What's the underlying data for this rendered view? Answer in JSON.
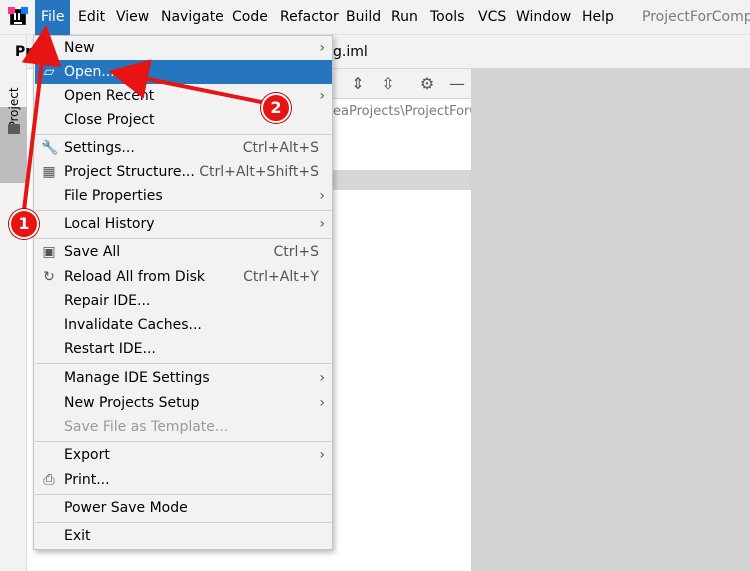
{
  "menubar": {
    "items": [
      "File",
      "Edit",
      "View",
      "Navigate",
      "Code",
      "Refactor",
      "Build",
      "Run",
      "Tools",
      "VCS",
      "Window",
      "Help"
    ],
    "title": "ProjectForComp("
  },
  "left_stripe": {
    "project_tab": "Project"
  },
  "tabs": {
    "left": "Pro",
    "file": "g.iml"
  },
  "project_path": "eaProjects\\ProjectForC",
  "file_menu": {
    "new": {
      "label": "New"
    },
    "open": {
      "label": "Open..."
    },
    "open_recent": {
      "label": "Open Recent"
    },
    "close_project": {
      "label": "Close Project"
    },
    "settings": {
      "label": "Settings...",
      "shortcut": "Ctrl+Alt+S"
    },
    "project_structure": {
      "label": "Project Structure...",
      "shortcut": "Ctrl+Alt+Shift+S"
    },
    "file_properties": {
      "label": "File Properties"
    },
    "local_history": {
      "label": "Local History"
    },
    "save_all": {
      "label": "Save All",
      "shortcut": "Ctrl+S"
    },
    "reload_all": {
      "label": "Reload All from Disk",
      "shortcut": "Ctrl+Alt+Y"
    },
    "repair_ide": {
      "label": "Repair IDE..."
    },
    "invalidate_caches": {
      "label": "Invalidate Caches..."
    },
    "restart_ide": {
      "label": "Restart IDE..."
    },
    "manage_ide_settings": {
      "label": "Manage IDE Settings"
    },
    "new_projects_setup": {
      "label": "New Projects Setup"
    },
    "save_file_as_template": {
      "label": "Save File as Template..."
    },
    "export": {
      "label": "Export"
    },
    "print": {
      "label": "Print..."
    },
    "power_save_mode": {
      "label": "Power Save Mode"
    },
    "exit": {
      "label": "Exit"
    }
  },
  "annotations": {
    "step1": "1",
    "step2": "2"
  },
  "colors": {
    "selection": "#2675bf",
    "annotation_red": "#e81313",
    "menu_bg": "#f2f2f2",
    "editor_bg": "#d2d2d2"
  },
  "icons": [
    "intellij-logo-icon",
    "folder-icon",
    "wrench-icon",
    "project-structure-icon",
    "save-icon",
    "reload-icon",
    "printer-icon",
    "submenu-arrow-icon",
    "gear-icon",
    "minimize-icon",
    "expand-all-icon",
    "collapse-all-icon"
  ]
}
